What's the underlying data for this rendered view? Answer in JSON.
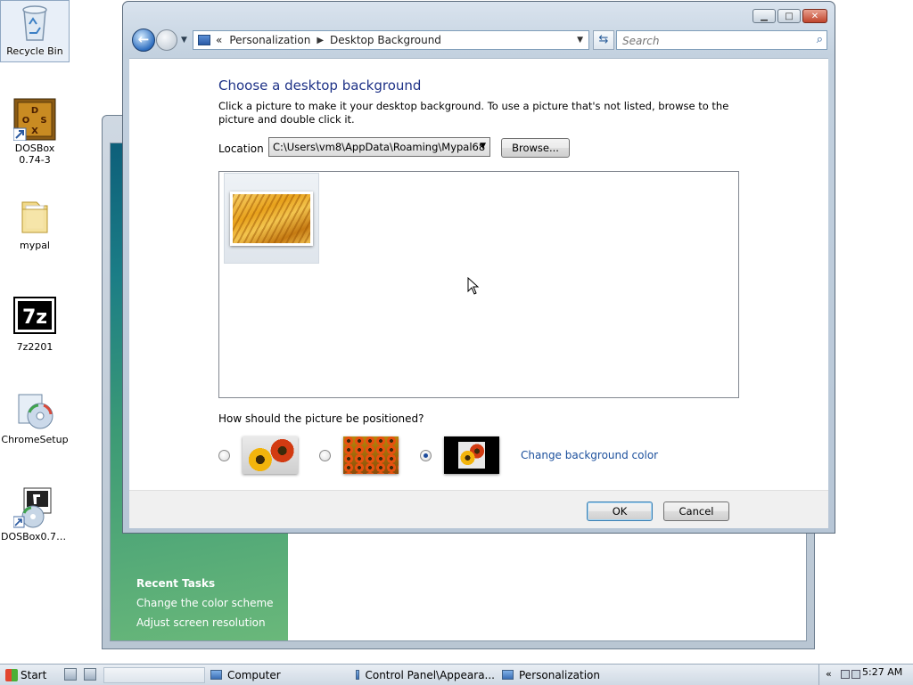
{
  "desktop": {
    "icons": [
      {
        "label": "Recycle Bin"
      },
      {
        "label": "DOSBox 0.74-3"
      },
      {
        "label": "mypal"
      },
      {
        "label": "7z2201"
      },
      {
        "label": "ChromeSetup"
      },
      {
        "label": "DOSBox0.74..."
      }
    ],
    "dosbox_logo": "DOSBOX",
    "sevenzip_logo": "7z"
  },
  "background_window": {
    "recent_tasks_heading": "Recent Tasks",
    "tasks": [
      "Change the color scheme",
      "Adjust screen resolution"
    ]
  },
  "dialog": {
    "breadcrumb": {
      "root_chevron": "«",
      "items": [
        "Personalization",
        "Desktop Background"
      ]
    },
    "search": {
      "placeholder": "Search"
    },
    "heading": "Choose a desktop background",
    "description": "Click a picture to make it your desktop background. To use a picture that's not listed, browse to the picture and double click it.",
    "location": {
      "label": "Location",
      "value": "C:\\Users\\vm8\\AppData\\Roaming\\Mypal68"
    },
    "browse_label": "Browse...",
    "position_question": "How should the picture be positioned?",
    "position_options": [
      {
        "mode": "fit-to-screen",
        "selected": false
      },
      {
        "mode": "tile",
        "selected": false
      },
      {
        "mode": "center",
        "selected": true
      }
    ],
    "change_color_link": "Change background color",
    "ok_label": "OK",
    "cancel_label": "Cancel"
  },
  "taskbar": {
    "start_label": "Start",
    "items": [
      "Computer",
      "Control Panel\\Appeara...",
      "Personalization"
    ],
    "clock": "5:27 AM"
  },
  "colors": {
    "heading": "#1e3287",
    "link": "#1b4f9c",
    "sidebar_green": "#3c9a75"
  }
}
